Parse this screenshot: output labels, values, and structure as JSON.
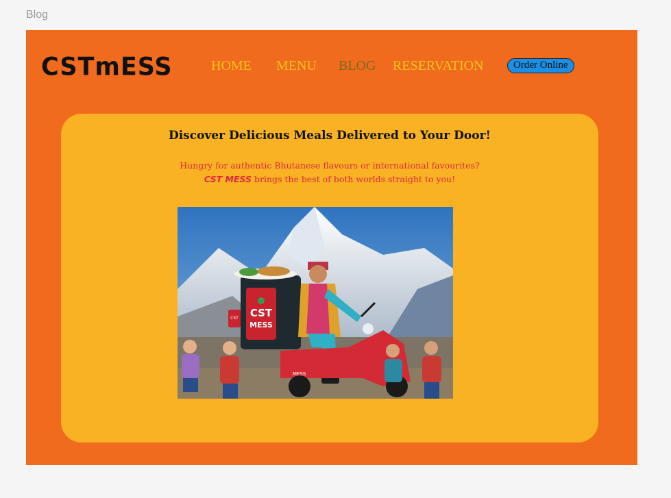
{
  "frame": {
    "label": "Blog"
  },
  "header": {
    "logo": "CSTmESS",
    "nav": [
      {
        "label": "HOME",
        "active": false
      },
      {
        "label": "MENU",
        "active": false
      },
      {
        "label": "BLOG",
        "active": true
      },
      {
        "label": "RESERVATION",
        "active": false
      }
    ],
    "order_button": "Order Online"
  },
  "hero_card": {
    "headline": "Discover Delicious Meals Delivered to Your Door!",
    "intro_line1": "Hungry for authentic Bhutanese flavours or international favourites?",
    "intro_brand": "CST MESS",
    "intro_line2_rest": " brings the best of both worlds straight to you!",
    "image": {
      "bag_text_line1": "CST",
      "bag_text_line2": "MESS",
      "bag_small_tag": "CST",
      "scooter_text": "MESS"
    }
  },
  "colors": {
    "page_background": "#f5f5f5",
    "frame_orange": "#f06b1d",
    "card_yellow": "#f8b223",
    "nav_yellow": "#f9c21d",
    "nav_active": "#7b6a1c",
    "button_blue": "#1b8ee6",
    "intro_red": "#e0283f"
  }
}
